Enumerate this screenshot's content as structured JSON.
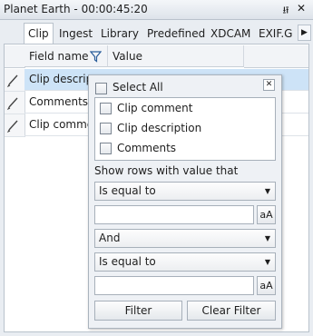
{
  "window": {
    "title": "Planet Earth - 00:00:45:20"
  },
  "icons": {
    "pin": "pin-icon",
    "close": "close-icon",
    "filter": "funnel-icon",
    "edit": "pencil-icon"
  },
  "tabs": [
    "Clip",
    "Ingest",
    "Library",
    "Predefined",
    "XDCAM",
    "EXIF.G"
  ],
  "grid": {
    "columns": [
      "Field name",
      "Value"
    ],
    "rows": [
      "Clip descript",
      "Comments",
      "Clip comme"
    ]
  },
  "filter_popup": {
    "select_all": "Select All",
    "items": [
      "Clip comment",
      "Clip description",
      "Comments"
    ],
    "show_rows_label": "Show rows with value that",
    "operator1": "Is equal to",
    "value1": "",
    "case_button": "aA",
    "logic": "And",
    "operator2": "Is equal to",
    "value2": "",
    "filter_button": "Filter",
    "clear_button": "Clear Filter"
  },
  "colors": {
    "selected_row": "#cde3f7",
    "header_bg": "#f2f4f7"
  }
}
